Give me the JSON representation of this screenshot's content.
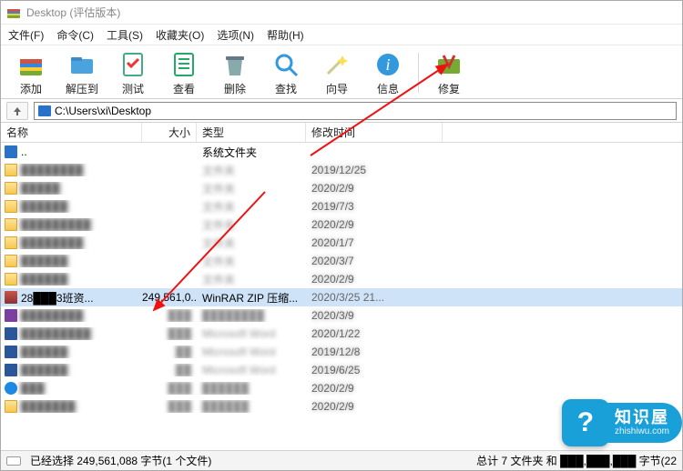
{
  "window": {
    "title": "Desktop (评估版本)"
  },
  "menus": [
    "文件(F)",
    "命令(C)",
    "工具(S)",
    "收藏夹(O)",
    "选项(N)",
    "帮助(H)"
  ],
  "toolbar": [
    {
      "name": "add",
      "label": "添加"
    },
    {
      "name": "extract",
      "label": "解压到"
    },
    {
      "name": "test",
      "label": "测试"
    },
    {
      "name": "view",
      "label": "查看"
    },
    {
      "name": "delete",
      "label": "删除"
    },
    {
      "name": "find",
      "label": "查找"
    },
    {
      "name": "wizard",
      "label": "向导"
    },
    {
      "name": "info",
      "label": "信息"
    },
    {
      "name": "repair",
      "label": "修复"
    }
  ],
  "path": "C:\\Users\\xi\\Desktop",
  "columns": {
    "name": "名称",
    "size": "大小",
    "type": "类型",
    "date": "修改时间"
  },
  "rows": [
    {
      "icon": "parent",
      "name": "..",
      "size": "",
      "type": "系统文件夹",
      "date": ""
    },
    {
      "icon": "folder",
      "name": "████████",
      "size": "",
      "type": "文件夹",
      "date": "2019/12/25",
      "blurred": true
    },
    {
      "icon": "folder",
      "name": "█████",
      "size": "",
      "type": "文件夹",
      "date": "2020/2/9",
      "blurred": true
    },
    {
      "icon": "folder",
      "name": "██████",
      "size": "",
      "type": "文件夹",
      "date": "2019/7/3",
      "blurred": true
    },
    {
      "icon": "folder",
      "name": "█████████",
      "size": "",
      "type": "文件夹",
      "date": "2020/2/9",
      "blurred": true
    },
    {
      "icon": "folder",
      "name": "████████",
      "size": "",
      "type": "文件夹",
      "date": "2020/1/7",
      "blurred": true
    },
    {
      "icon": "folder",
      "name": "██████",
      "size": "",
      "type": "文件夹",
      "date": "2020/3/7",
      "blurred": true
    },
    {
      "icon": "folder",
      "name": "██████",
      "size": "",
      "type": "文件夹",
      "date": "2020/2/9",
      "blurred": true
    },
    {
      "icon": "rar",
      "name": "28███3班资...",
      "size": "249,561,0...",
      "type": "WinRAR ZIP 压缩...",
      "date": "2020/3/25 21...",
      "selected": true
    },
    {
      "icon": "purple",
      "name": "████████",
      "size": "███",
      "type": "████████",
      "date": "2020/3/9",
      "blurred": true
    },
    {
      "icon": "word",
      "name": "█████████",
      "size": "███",
      "type": "Microsoft Word",
      "date": "2020/1/22",
      "blurred": true
    },
    {
      "icon": "word",
      "name": "██████",
      "size": "██",
      "type": "Microsoft Word",
      "date": "2019/12/8",
      "blurred": true
    },
    {
      "icon": "word",
      "name": "██████",
      "size": "██",
      "type": "Microsoft Word",
      "date": "2019/6/25",
      "blurred": true
    },
    {
      "icon": "ie",
      "name": "███",
      "size": "███",
      "type": "██████",
      "date": "2020/2/9",
      "blurred": true
    },
    {
      "icon": "folder",
      "name": "███████",
      "size": "███",
      "type": "██████",
      "date": "2020/2/9",
      "blurred": true
    }
  ],
  "status": {
    "left": "已经选择 249,561,088 字节(1 个文件)",
    "right": "总计 7 文件夹 和 ███,███,███ 字节(22"
  },
  "watermark": {
    "title": "知识屋",
    "sub": "zhishiwu.com"
  }
}
